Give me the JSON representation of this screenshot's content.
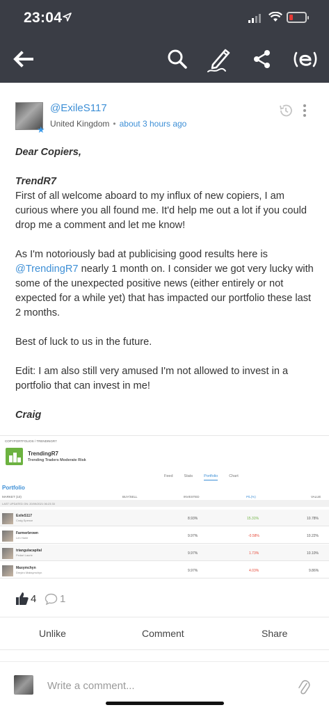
{
  "status_bar": {
    "time": "23:04",
    "battery_level": 0.12,
    "battery_color": "#e53935"
  },
  "toolbar": {
    "back_icon": "arrow-left-icon",
    "search_icon": "search-icon",
    "edit_icon": "pencil-icon",
    "share_icon": "share-icon",
    "logo_icon": "etoro-logo-icon"
  },
  "post": {
    "username": "@ExileS117",
    "location": "United Kingdom",
    "time_ago": "about 3 hours ago",
    "body": {
      "greeting": "Dear Copiers,",
      "heading": "TrendR7",
      "p1": "First of all welcome aboard to my influx of new copiers, I am curious where you all found me. It'd help me out a lot if you could drop me a comment and let me know!",
      "p2_before": "As I'm notoriously bad at publicising good results here is ",
      "p2_mention": "@TrendingR7",
      "p2_after": " nearly 1 month on. I consider we got very lucky with some of the unexpected positive news (either entirely or not expected for a while yet) that has impacted our portfolio these last 2 months.",
      "p3": "Best of luck to us in the future.",
      "p4": "Edit: I am also still very amused I'm not allowed to invest in a portfolio that can invest in me!",
      "signature": "Craig"
    }
  },
  "attachment": {
    "breadcrumb": "COPYPORTFOLIOS / TRENDINGR7",
    "portfolio_name": "TrendingR7",
    "portfolio_desc": "Trending Traders Moderate Risk",
    "tabs": [
      "Feed",
      "Stats",
      "Portfolio",
      "Chart"
    ],
    "active_tab": "Portfolio",
    "section_title": "Portfolio",
    "columns": [
      "MARKET (10)",
      "BUY/SELL",
      "INVESTED",
      "P/L(%)",
      "VALUE"
    ],
    "last_updated": "LAST UPDATED ON: 20/09/2021 06:23:33",
    "rows": [
      {
        "name": "ExileS117",
        "full": "Craig Spence",
        "invested": "8.93%",
        "pl": "15.31%",
        "value": "10.78%"
      },
      {
        "name": "Farmerbrown",
        "full": "Len Harle",
        "invested": "9.97%",
        "pl": "-0.58%",
        "value": "10.22%"
      },
      {
        "name": "triangulacapital",
        "full": "Pedari Laurie",
        "invested": "9.97%",
        "pl": "1.73%",
        "value": "10.10%"
      },
      {
        "name": "Maxymchyn",
        "full": "Dmytro Maksymchyn",
        "invested": "9.97%",
        "pl": "4.03%",
        "value": "9.86%"
      }
    ]
  },
  "reactions": {
    "likes": "4",
    "comments": "1"
  },
  "actions": {
    "unlike": "Unlike",
    "comment": "Comment",
    "share": "Share"
  },
  "composer": {
    "placeholder": "Write a comment..."
  },
  "colors": {
    "topbar": "#3a3d45",
    "link": "#3d8fd6",
    "positive": "#6cb240",
    "negative": "#e74c3c"
  }
}
